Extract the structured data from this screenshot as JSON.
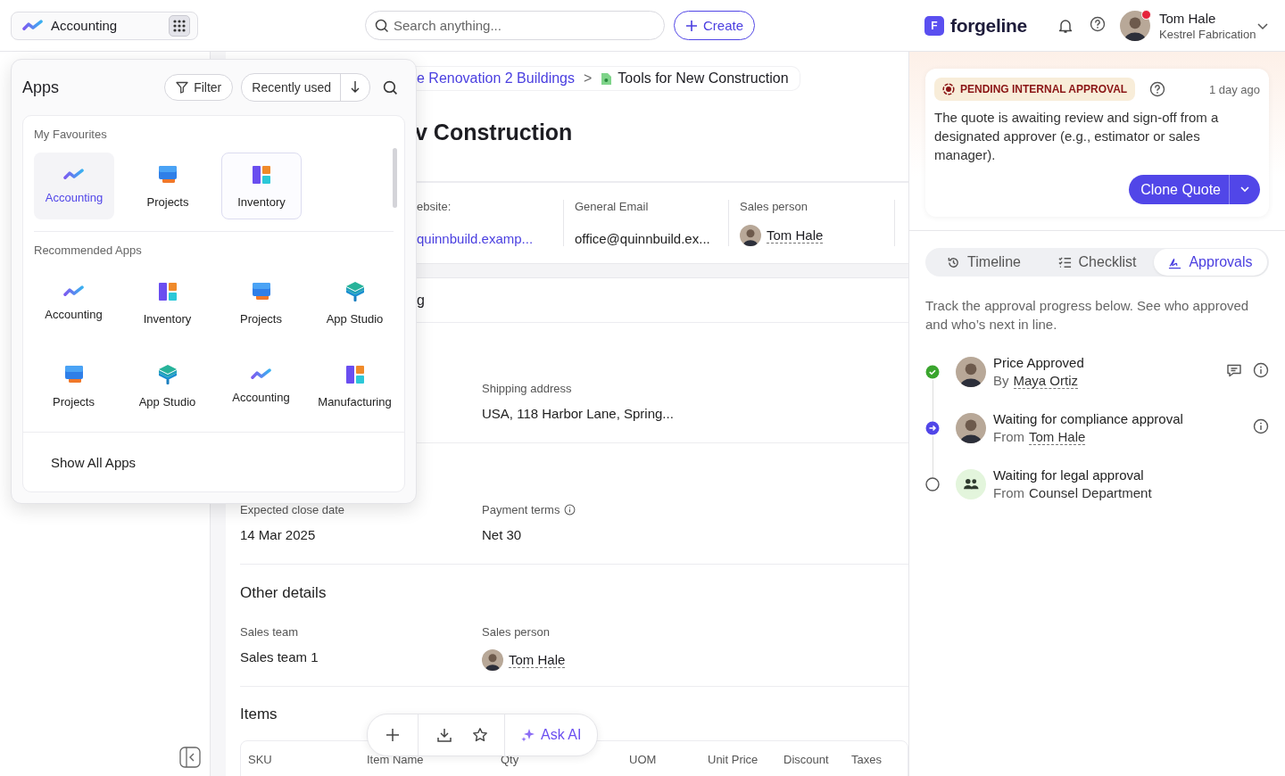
{
  "app_switcher": {
    "label": "Accounting",
    "kind": "accounting"
  },
  "search": {
    "placeholder": "Search anything..."
  },
  "create_button": "Create",
  "brand": {
    "letter": "F",
    "name": "forgeline"
  },
  "user": {
    "name": "Tom Hale",
    "company": "Kestrel Fabrication",
    "notification": true
  },
  "apps_popup": {
    "title": "Apps",
    "filter": "Filter",
    "sort": "Recently used",
    "favourites_title": "My Favourites",
    "favourites": [
      {
        "name": "Accounting",
        "kind": "accounting",
        "selected": true,
        "hovered": false
      },
      {
        "name": "Projects",
        "kind": "projects",
        "selected": false,
        "hovered": false
      },
      {
        "name": "Inventory",
        "kind": "inventory",
        "selected": false,
        "hovered": true
      }
    ],
    "recommended_title": "Recommended Apps",
    "recommended": [
      {
        "name": "Accounting",
        "kind": "accounting"
      },
      {
        "name": "Inventory",
        "kind": "inventory"
      },
      {
        "name": "Projects",
        "kind": "projects"
      },
      {
        "name": "App Studio",
        "kind": "app_studio"
      },
      {
        "name": "Projects",
        "kind": "projects"
      },
      {
        "name": "App Studio",
        "kind": "app_studio"
      },
      {
        "name": "Accounting",
        "kind": "accounting"
      },
      {
        "name": "Manufacturing",
        "kind": "inventory"
      }
    ],
    "show_all": "Show All Apps"
  },
  "breadcrumb": {
    "parent": "e Renovation 2 Buildings",
    "separator": ">",
    "current": "Tools for New Construction"
  },
  "title": "v Construction",
  "info_strip": [
    {
      "label": "ebsite:",
      "value": "quinnbuild.examp...",
      "kind": "link"
    },
    {
      "label": "General Email",
      "value": "office@quinnbuild.ex...",
      "kind": "text"
    },
    {
      "label": "Sales person",
      "value": "Tom Hale",
      "kind": "person"
    }
  ],
  "section_fragment": "g",
  "address": {
    "label": "Shipping address",
    "value": "USA, 118 Harbor Lane, Spring..."
  },
  "dates": [
    {
      "label": "Expected close date",
      "value": "14 Mar 2025",
      "info": false
    },
    {
      "label": "Payment terms",
      "value": "Net 30",
      "info": true
    }
  ],
  "other_details": {
    "title": "Other details",
    "fields": [
      {
        "label": "Sales team",
        "value": "Sales team 1",
        "kind": "text"
      },
      {
        "label": "Sales person",
        "value": "Tom Hale",
        "kind": "person"
      }
    ]
  },
  "items": {
    "title": "Items",
    "columns": [
      "SKU",
      "Item Name",
      "Qty",
      "UOM",
      "Unit Price",
      "Discount",
      "Taxes"
    ]
  },
  "action_bar": {
    "ask_ai": "Ask AI"
  },
  "status_card": {
    "badge": "PENDING INTERNAL APPROVAL",
    "time": "1 day ago",
    "text": "The quote is awaiting review and sign-off from a designated approver (e.g., estimator or sales manager).",
    "button": "Clone Quote"
  },
  "panel_tabs": [
    {
      "label": "Timeline",
      "kind": "history",
      "selected": false
    },
    {
      "label": "Checklist",
      "kind": "checklist",
      "selected": false
    },
    {
      "label": "Approvals",
      "kind": "signature",
      "selected": true
    }
  ],
  "approvals": {
    "intro": "Track the approval progress below. See who approved and who’s next in line.",
    "steps": [
      {
        "title": "Price Approved",
        "prefix": "By",
        "person": "Maya Ortiz",
        "kind": "approved",
        "group": false,
        "linked": true,
        "comment": true,
        "info": true
      },
      {
        "title": "Waiting for compliance approval",
        "prefix": "From",
        "person": "Tom Hale",
        "kind": "current",
        "group": false,
        "linked": true,
        "comment": false,
        "info": true
      },
      {
        "title": "Waiting for legal approval",
        "prefix": "From",
        "person": "Counsel Department",
        "kind": "pending",
        "group": true,
        "linked": false,
        "comment": false,
        "info": false
      }
    ]
  }
}
